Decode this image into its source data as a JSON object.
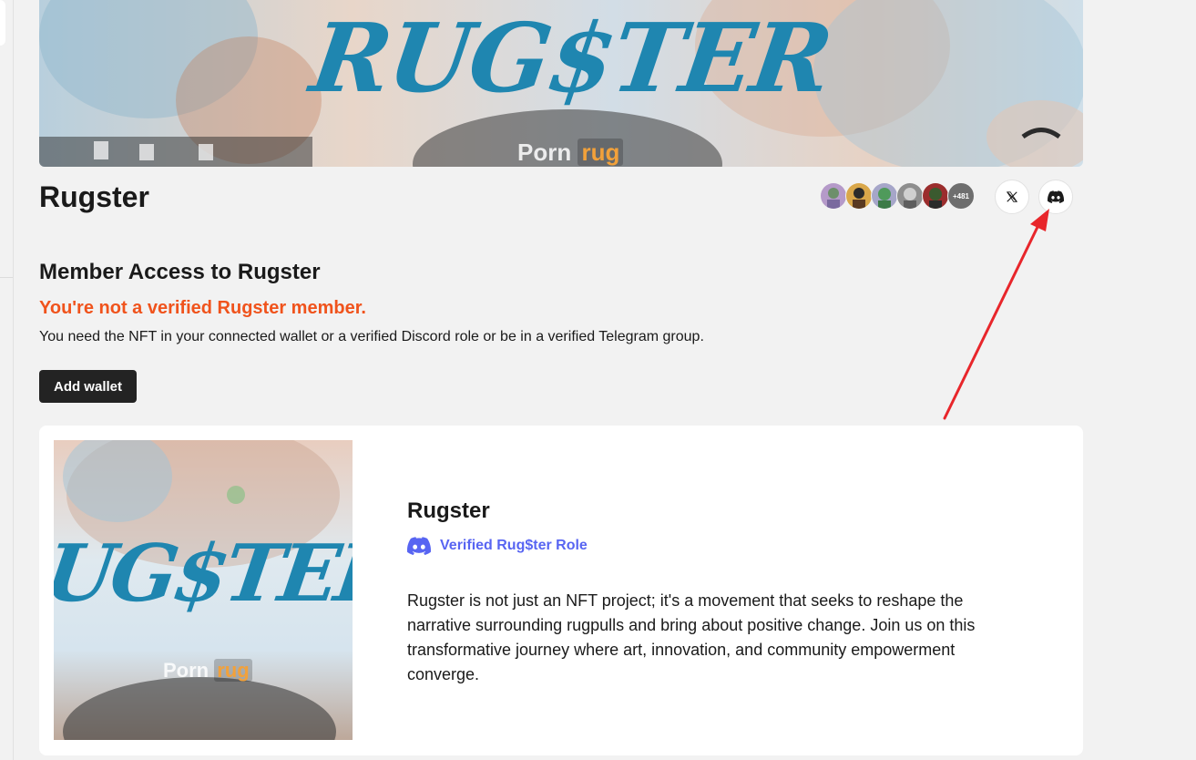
{
  "project": {
    "title": "Rugster",
    "banner_title": "RUG$TER",
    "banner_tag_pre": "Porn",
    "banner_tag_hl": "rug"
  },
  "members": {
    "extra_count": "+481",
    "avatars": [
      {
        "name": "member-avatar-1",
        "color": "#b59ac9"
      },
      {
        "name": "member-avatar-2",
        "color": "#d9a74a"
      },
      {
        "name": "member-avatar-3",
        "color": "#4f9a5b"
      },
      {
        "name": "member-avatar-4",
        "color": "#8e8e8e"
      },
      {
        "name": "member-avatar-5",
        "color": "#9b2d2d"
      }
    ]
  },
  "social": {
    "x_icon": "x-logo-icon",
    "discord_icon": "discord-icon"
  },
  "access": {
    "heading": "Member Access to Rugster",
    "warning": "You're not a verified Rugster member.",
    "description": "You need the NFT in your connected wallet or a verified Discord role or be in a verified Telegram group.",
    "add_wallet_label": "Add wallet"
  },
  "card": {
    "name": "Rugster",
    "role_label": "Verified Rug$ter Role",
    "role_icon": "discord-icon",
    "description": "Rugster is not just an NFT project; it's a movement that seeks to reshape the narrative surrounding rugpulls and bring about positive change. Join us on this transformative journey where art, innovation, and community empowerment converge.",
    "image_art": "UG$TER",
    "image_tag_pre": "Porn",
    "image_tag_hl": "rug"
  },
  "colors": {
    "warning": "#f0531c",
    "discord": "#5865f2",
    "annotation_arrow": "#e8262b",
    "button_bg": "#232323"
  }
}
